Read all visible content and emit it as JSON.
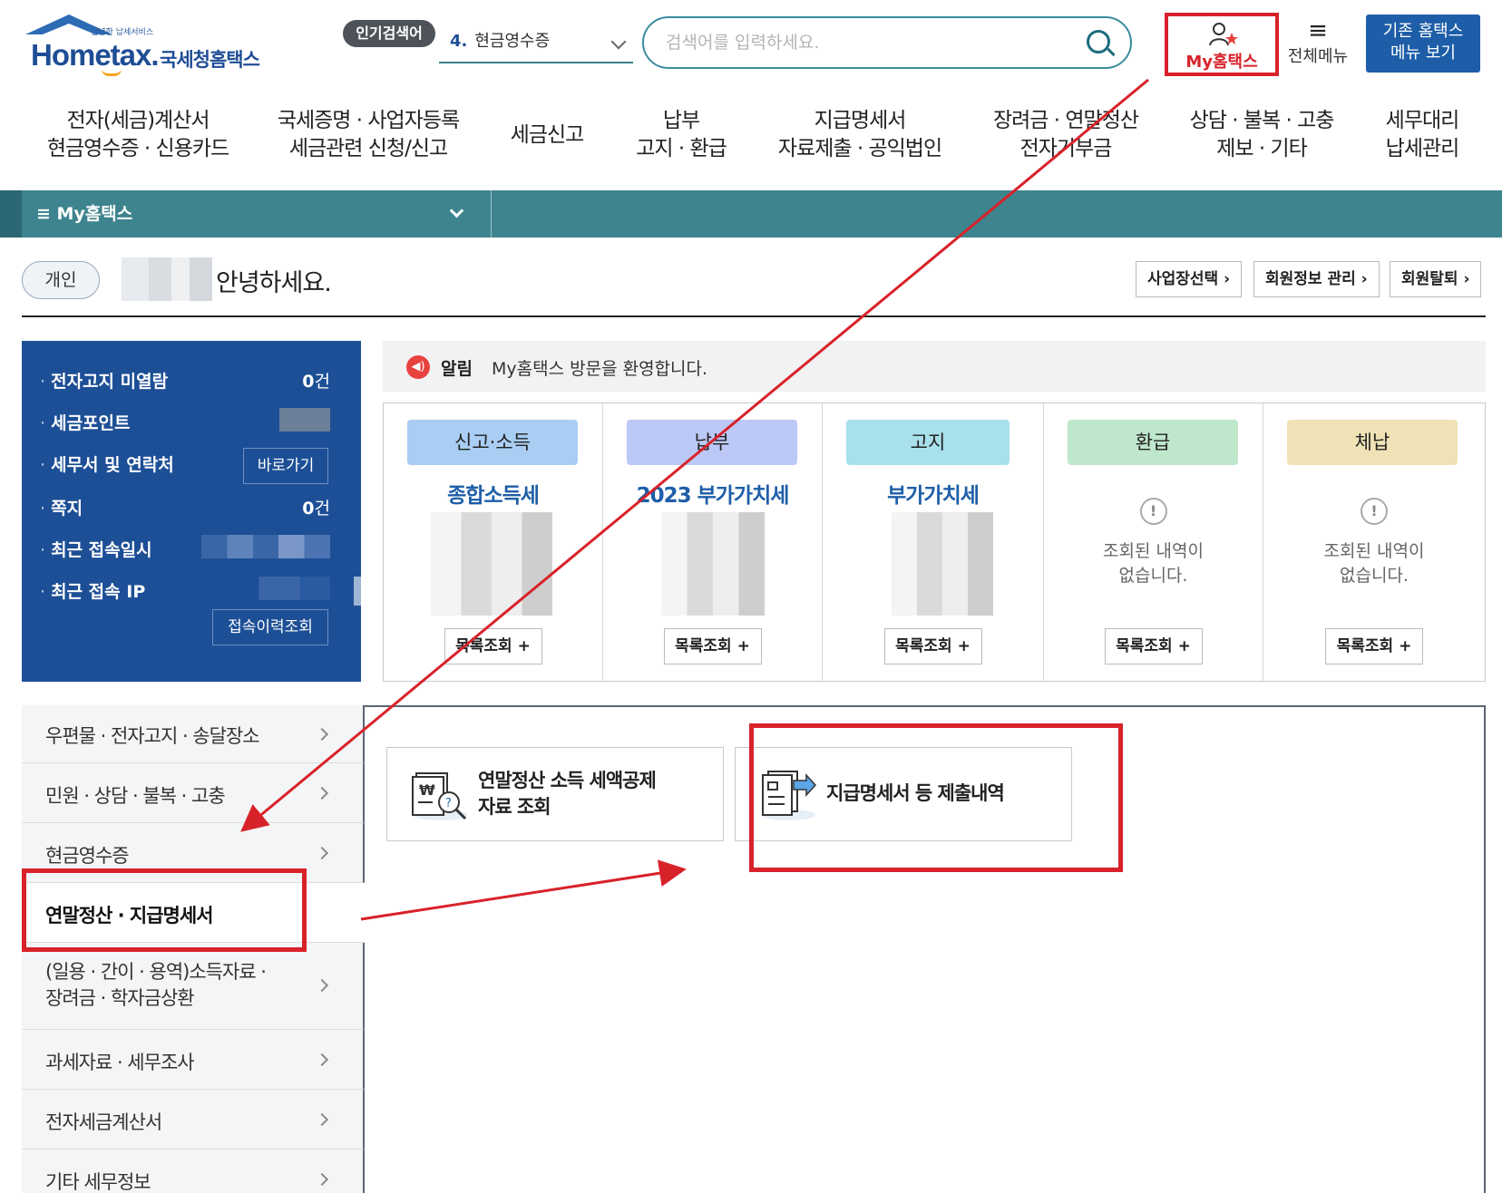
{
  "header": {
    "logo_small": "안녕한 납세서비스",
    "logo_text": "Hometax.",
    "logo_name": "국세청홈택스",
    "popular_badge": "인기검색어",
    "popular_num": "4.",
    "popular_text": "현금영수증",
    "search_placeholder": "검색어를 입력하세요.",
    "my_hometax": "My홈택스",
    "all_menu": "전체메뉴",
    "old_menu_line1": "기존 홈택스",
    "old_menu_line2": "메뉴 보기"
  },
  "topnav": [
    {
      "l1": "전자(세금)계산서",
      "l2": "현금영수증 · 신용카드"
    },
    {
      "l1": "국세증명 · 사업자등록",
      "l2": "세금관련 신청/신고"
    },
    {
      "l1": "세금신고",
      "l2": ""
    },
    {
      "l1": "납부",
      "l2": "고지 · 환급"
    },
    {
      "l1": "지급명세서",
      "l2": "자료제출 · 공익법인"
    },
    {
      "l1": "장려금 · 연말정산",
      "l2": "전자기부금"
    },
    {
      "l1": "상담 · 불복 · 고충",
      "l2": "제보 · 기타"
    },
    {
      "l1": "세무대리",
      "l2": "납세관리"
    }
  ],
  "mybar": {
    "label": "≡  My홈택스"
  },
  "greeting": {
    "type_badge": "개인",
    "text": "안녕하세요.",
    "buttons": [
      "사업장선택 ›",
      "회원정보 관리 ›",
      "회원탈퇴 ›"
    ]
  },
  "info_panel": {
    "rows": [
      {
        "label": "전자고지 미열람",
        "count": "0",
        "unit": "건"
      },
      {
        "label": "세금포인트"
      },
      {
        "label": "세무서 및 연락처",
        "button": "바로가기"
      },
      {
        "label": "쪽지",
        "count": "0",
        "unit": "건"
      },
      {
        "label": "최근 접속일시"
      },
      {
        "label": "최근 접속 IP"
      }
    ],
    "history_button": "접속이력조회"
  },
  "notice": {
    "tag": "알림",
    "message": "My홈택스 방문을 환영합니다."
  },
  "cards": [
    {
      "head": "신고·소득",
      "sub": "종합소득세",
      "more": "목록조회 +",
      "color": "#a9cdf3"
    },
    {
      "head": "납부",
      "sub": "2023 부가가치세",
      "more": "목록조회 +",
      "color": "#bcc8f5"
    },
    {
      "head": "고지",
      "sub": "부가가치세",
      "more": "목록조회 +",
      "color": "#a8e0ec"
    },
    {
      "head": "환급",
      "empty1": "조회된 내역이",
      "empty2": "없습니다.",
      "more": "목록조회 +",
      "color": "#bfe7cb"
    },
    {
      "head": "체납",
      "empty1": "조회된 내역이",
      "empty2": "없습니다.",
      "more": "목록조회 +",
      "color": "#f0e2b6"
    }
  ],
  "side_menu": [
    {
      "label": "우편물 · 전자고지 · 송달장소"
    },
    {
      "label": "민원 · 상담 · 불복 · 고충"
    },
    {
      "label": "현금영수증"
    },
    {
      "label": "연말정산 · 지급명세서"
    },
    {
      "label": "(일용 · 간이 · 용역)소득자료 ·",
      "label2": "장려금 · 학자금상환"
    },
    {
      "label": "과세자료 · 세무조사"
    },
    {
      "label": "전자세금계산서"
    },
    {
      "label": "기타 세무정보"
    }
  ],
  "services": [
    {
      "l1": "연말정산 소득 세액공제",
      "l2": "자료 조회"
    },
    {
      "l1": "지급명세서 등 제출내역",
      "l2": ""
    }
  ],
  "colors": {
    "annotation": "#d8222a",
    "brand": "#1d4f96",
    "teal": "#3e848f"
  }
}
